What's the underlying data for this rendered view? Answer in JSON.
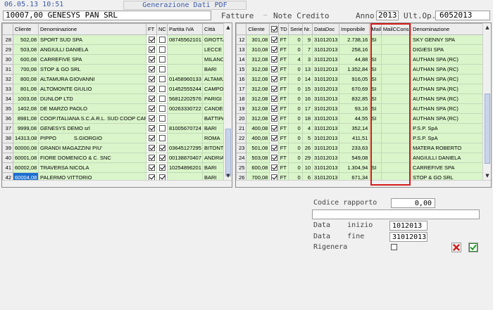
{
  "header": {
    "datetime": "06.05.13 10:51",
    "title": "Generazione Dati PDF",
    "cliente": "10007,00 GENESYS PAN SRL",
    "fatture_label": "Fatture",
    "note_credito_label": "Note Credito",
    "anno_label": "Anno",
    "anno_value": "2013",
    "ult_op_label": "Ult.Op.",
    "ult_op_value": "6052013"
  },
  "left_table": {
    "columns": [
      "Cliente",
      "Denominazione",
      "FT",
      "NC",
      "Partita IVA",
      "Città"
    ],
    "rows": [
      {
        "n": "28",
        "cliente": "502,08",
        "den": "SPORT SUD SPA",
        "ft": true,
        "nc": false,
        "piva": "08745562101",
        "citta": "GROTTA"
      },
      {
        "n": "29",
        "cliente": "503,08",
        "den": "ANGIULLI DANIELA",
        "ft": true,
        "nc": false,
        "piva": "",
        "citta": "LECCE"
      },
      {
        "n": "30",
        "cliente": "600,08",
        "den": "CARREFIVE SPA",
        "ft": true,
        "nc": false,
        "piva": "",
        "citta": "MILANO"
      },
      {
        "n": "31",
        "cliente": "700,08",
        "den": "STOP & GO SRL",
        "ft": true,
        "nc": false,
        "piva": "",
        "citta": "BARI"
      },
      {
        "n": "32",
        "cliente": "800,08",
        "den": "ALTAMURA GIOVANNI",
        "ft": true,
        "nc": false,
        "piva": "01458960133",
        "citta": "ALTAMU"
      },
      {
        "n": "33",
        "cliente": "801,08",
        "den": "ALTOMONTE GIULIO",
        "ft": true,
        "nc": false,
        "piva": "01452555244",
        "citta": "CAMPOE"
      },
      {
        "n": "34",
        "cliente": "1003,08",
        "den": "DUNLOP LTD",
        "ft": true,
        "nc": false,
        "piva": "56812202576",
        "citta": "PARIGI"
      },
      {
        "n": "35",
        "cliente": "1402,08",
        "den": "DE MARZO PAOLO",
        "ft": true,
        "nc": false,
        "piva": "00263330722",
        "citta": "CANDEL"
      },
      {
        "n": "36",
        "cliente": "8981,08",
        "den": "COOP.ITALIANA S.C.A.R.L. SUD COOP CARN",
        "ft": true,
        "nc": false,
        "piva": "",
        "citta": "BATTIPA"
      },
      {
        "n": "37",
        "cliente": "9999,08",
        "den": "GENESYS DEMO srl",
        "ft": true,
        "nc": false,
        "piva": "81005670724",
        "citta": "BARI"
      },
      {
        "n": "38",
        "cliente": "14313,08",
        "den": "PIPPO            S.GIORGIO",
        "ft": true,
        "nc": false,
        "piva": "",
        "citta": "ROMA"
      },
      {
        "n": "39",
        "cliente": "60000,08",
        "den": "GRANDI MAGAZZINI PIU'",
        "ft": true,
        "nc": true,
        "piva": "03645127295",
        "citta": "BITONTC"
      },
      {
        "n": "40",
        "cliente": "60001,08",
        "den": "FIORE DOMENICO & C. SNC",
        "ft": true,
        "nc": true,
        "piva": "00138870407",
        "citta": "ANDRIA"
      },
      {
        "n": "41",
        "cliente": "60002,08",
        "den": "TRAVERSA NICOLA",
        "ft": true,
        "nc": true,
        "piva": "10254896201",
        "citta": "BARI"
      },
      {
        "n": "42",
        "cliente": "60004,08",
        "den": "PALERMO VITTORIO",
        "ft": true,
        "nc": true,
        "piva": "",
        "citta": "BARI"
      }
    ]
  },
  "right_table": {
    "columns": [
      "Cliente",
      "TD",
      "Serie",
      "Nr.",
      "DataDoc",
      "Imponibile",
      "Mail",
      "MailCCons",
      "Denominazione"
    ],
    "rows": [
      {
        "n": "12",
        "cliente": "301,08",
        "td": "FT",
        "serie": "0",
        "nr": "9",
        "data": "31012013",
        "imp": "2.738,16",
        "mail": "SI",
        "mailcc": "",
        "den": "SKY GENNY SPA"
      },
      {
        "n": "13",
        "cliente": "310,08",
        "td": "FT",
        "serie": "0",
        "nr": "7",
        "data": "31012013",
        "imp": "258,16",
        "mail": "",
        "mailcc": "",
        "den": "DIGIESI SPA"
      },
      {
        "n": "14",
        "cliente": "312,08",
        "td": "FT",
        "serie": "4",
        "nr": "3",
        "data": "31012013",
        "imp": "44,88",
        "mail": "SI",
        "mailcc": "",
        "den": "AUTHAN SPA (RC)"
      },
      {
        "n": "15",
        "cliente": "312,08",
        "td": "FT",
        "serie": "0",
        "nr": "13",
        "data": "31012013",
        "imp": "1.352,84",
        "mail": "SI",
        "mailcc": "",
        "den": "AUTHAN SPA (RC)"
      },
      {
        "n": "16",
        "cliente": "312,08",
        "td": "FT",
        "serie": "0",
        "nr": "14",
        "data": "31012013",
        "imp": "916,05",
        "mail": "SI",
        "mailcc": "",
        "den": "AUTHAN SPA (RC)"
      },
      {
        "n": "17",
        "cliente": "312,08",
        "td": "FT",
        "serie": "0",
        "nr": "15",
        "data": "31012013",
        "imp": "670,69",
        "mail": "SI",
        "mailcc": "",
        "den": "AUTHAN SPA (RC)"
      },
      {
        "n": "18",
        "cliente": "312,08",
        "td": "FT",
        "serie": "0",
        "nr": "16",
        "data": "31012013",
        "imp": "832,85",
        "mail": "SI",
        "mailcc": "",
        "den": "AUTHAN SPA (RC)"
      },
      {
        "n": "19",
        "cliente": "312,08",
        "td": "FT",
        "serie": "0",
        "nr": "17",
        "data": "31012013",
        "imp": "93,16",
        "mail": "SI",
        "mailcc": "",
        "den": "AUTHAN SPA (RC)"
      },
      {
        "n": "20",
        "cliente": "312,08",
        "td": "FT",
        "serie": "0",
        "nr": "18",
        "data": "31012013",
        "imp": "44,55",
        "mail": "SI",
        "mailcc": "",
        "den": "AUTHAN SPA (RC)"
      },
      {
        "n": "21",
        "cliente": "400,08",
        "td": "FT",
        "serie": "0",
        "nr": "4",
        "data": "31012013",
        "imp": "352,14",
        "mail": "",
        "mailcc": "",
        "den": "P.S.P. SpA"
      },
      {
        "n": "22",
        "cliente": "400,08",
        "td": "FT",
        "serie": "0",
        "nr": "5",
        "data": "31012013",
        "imp": "411,51",
        "mail": "",
        "mailcc": "",
        "den": "P.S.P. SpA"
      },
      {
        "n": "23",
        "cliente": "501,08",
        "td": "FT",
        "serie": "0",
        "nr": "26",
        "data": "31012013",
        "imp": "233,63",
        "mail": "",
        "mailcc": "",
        "den": "MATERA ROBERTO"
      },
      {
        "n": "24",
        "cliente": "503,08",
        "td": "FT",
        "serie": "0",
        "nr": "29",
        "data": "31012013",
        "imp": "549,08",
        "mail": "",
        "mailcc": "",
        "den": "ANGIULLI DANIELA"
      },
      {
        "n": "25",
        "cliente": "600,08",
        "td": "FT",
        "serie": "0",
        "nr": "10",
        "data": "31012013",
        "imp": "1.304,94",
        "mail": "SI",
        "mailcc": "",
        "den": "CARREFIVE SPA"
      },
      {
        "n": "26",
        "cliente": "700,08",
        "td": "FT",
        "serie": "0",
        "nr": "6",
        "data": "31012013",
        "imp": "671,34",
        "mail": "",
        "mailcc": "",
        "den": "STOP & GO SRL"
      }
    ]
  },
  "form": {
    "codice_rapporto_label": "Codice rapporto",
    "codice_rapporto_value": "0,00",
    "descrizione_value": "",
    "data_inizio_label": "Data    inizio",
    "data_inizio_value": "1012013",
    "data_fine_label": "Data    fine",
    "data_fine_value": "31012013",
    "rigenera_label": "Rigenera"
  },
  "colors": {
    "row_green": "#d9f5c9",
    "selected": "#1c6ed0",
    "highlight_red": "#d61b1b",
    "title_blue": "#3a5aa8"
  },
  "icons": {
    "cancel": "red-x-icon",
    "confirm": "green-check-icon"
  }
}
